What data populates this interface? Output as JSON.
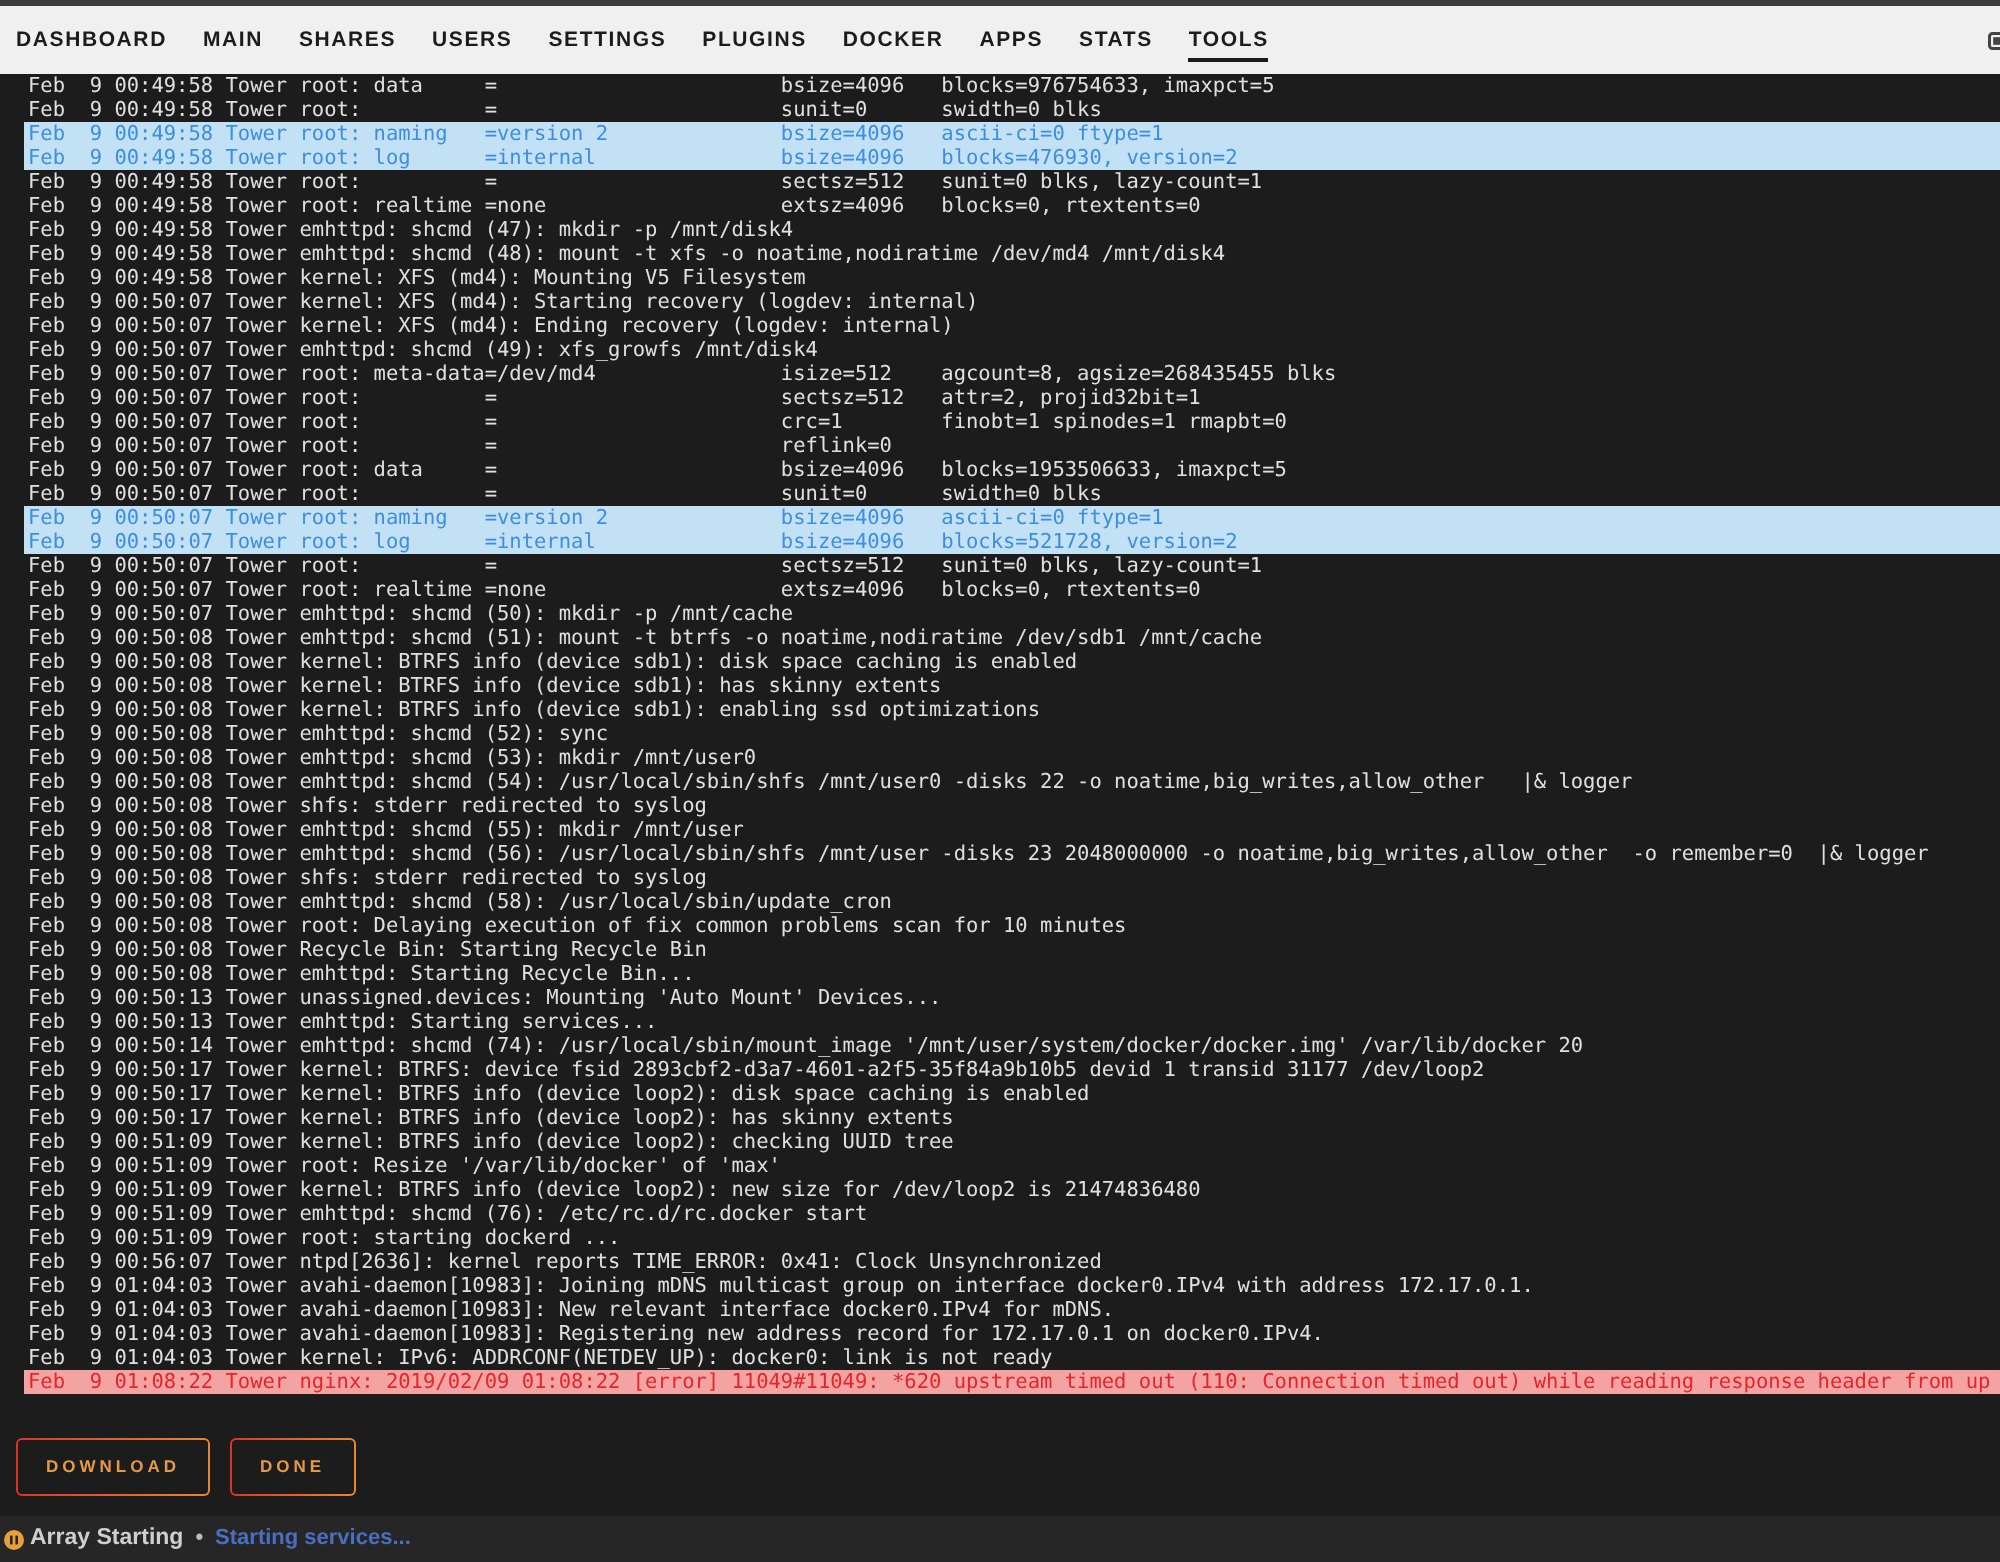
{
  "nav": {
    "tabs": [
      {
        "label": "DASHBOARD",
        "selected": false
      },
      {
        "label": "MAIN",
        "selected": false
      },
      {
        "label": "SHARES",
        "selected": false
      },
      {
        "label": "USERS",
        "selected": false
      },
      {
        "label": "SETTINGS",
        "selected": false
      },
      {
        "label": "PLUGINS",
        "selected": false
      },
      {
        "label": "DOCKER",
        "selected": false
      },
      {
        "label": "APPS",
        "selected": false
      },
      {
        "label": "STATS",
        "selected": false
      },
      {
        "label": "TOOLS",
        "selected": true
      }
    ]
  },
  "log": {
    "lines": [
      {
        "kind": "normal",
        "text": "Feb  9 00:49:58 Tower root: data     =                       bsize=4096   blocks=976754633, imaxpct=5"
      },
      {
        "kind": "normal",
        "text": "Feb  9 00:49:58 Tower root:          =                       sunit=0      swidth=0 blks"
      },
      {
        "kind": "highlight",
        "text": "Feb  9 00:49:58 Tower root: naming   =version 2              bsize=4096   ascii-ci=0 ftype=1"
      },
      {
        "kind": "highlight",
        "text": "Feb  9 00:49:58 Tower root: log      =internal               bsize=4096   blocks=476930, version=2"
      },
      {
        "kind": "normal",
        "text": "Feb  9 00:49:58 Tower root:          =                       sectsz=512   sunit=0 blks, lazy-count=1"
      },
      {
        "kind": "normal",
        "text": "Feb  9 00:49:58 Tower root: realtime =none                   extsz=4096   blocks=0, rtextents=0"
      },
      {
        "kind": "normal",
        "text": "Feb  9 00:49:58 Tower emhttpd: shcmd (47): mkdir -p /mnt/disk4"
      },
      {
        "kind": "normal",
        "text": "Feb  9 00:49:58 Tower emhttpd: shcmd (48): mount -t xfs -o noatime,nodiratime /dev/md4 /mnt/disk4"
      },
      {
        "kind": "normal",
        "text": "Feb  9 00:49:58 Tower kernel: XFS (md4): Mounting V5 Filesystem"
      },
      {
        "kind": "normal",
        "text": "Feb  9 00:50:07 Tower kernel: XFS (md4): Starting recovery (logdev: internal)"
      },
      {
        "kind": "normal",
        "text": "Feb  9 00:50:07 Tower kernel: XFS (md4): Ending recovery (logdev: internal)"
      },
      {
        "kind": "normal",
        "text": "Feb  9 00:50:07 Tower emhttpd: shcmd (49): xfs_growfs /mnt/disk4"
      },
      {
        "kind": "normal",
        "text": "Feb  9 00:50:07 Tower root: meta-data=/dev/md4               isize=512    agcount=8, agsize=268435455 blks"
      },
      {
        "kind": "normal",
        "text": "Feb  9 00:50:07 Tower root:          =                       sectsz=512   attr=2, projid32bit=1"
      },
      {
        "kind": "normal",
        "text": "Feb  9 00:50:07 Tower root:          =                       crc=1        finobt=1 spinodes=1 rmapbt=0"
      },
      {
        "kind": "normal",
        "text": "Feb  9 00:50:07 Tower root:          =                       reflink=0"
      },
      {
        "kind": "normal",
        "text": "Feb  9 00:50:07 Tower root: data     =                       bsize=4096   blocks=1953506633, imaxpct=5"
      },
      {
        "kind": "normal",
        "text": "Feb  9 00:50:07 Tower root:          =                       sunit=0      swidth=0 blks"
      },
      {
        "kind": "highlight",
        "text": "Feb  9 00:50:07 Tower root: naming   =version 2              bsize=4096   ascii-ci=0 ftype=1"
      },
      {
        "kind": "highlight",
        "text": "Feb  9 00:50:07 Tower root: log      =internal               bsize=4096   blocks=521728, version=2"
      },
      {
        "kind": "normal",
        "text": "Feb  9 00:50:07 Tower root:          =                       sectsz=512   sunit=0 blks, lazy-count=1"
      },
      {
        "kind": "normal",
        "text": "Feb  9 00:50:07 Tower root: realtime =none                   extsz=4096   blocks=0, rtextents=0"
      },
      {
        "kind": "normal",
        "text": "Feb  9 00:50:07 Tower emhttpd: shcmd (50): mkdir -p /mnt/cache"
      },
      {
        "kind": "normal",
        "text": "Feb  9 00:50:08 Tower emhttpd: shcmd (51): mount -t btrfs -o noatime,nodiratime /dev/sdb1 /mnt/cache"
      },
      {
        "kind": "normal",
        "text": "Feb  9 00:50:08 Tower kernel: BTRFS info (device sdb1): disk space caching is enabled"
      },
      {
        "kind": "normal",
        "text": "Feb  9 00:50:08 Tower kernel: BTRFS info (device sdb1): has skinny extents"
      },
      {
        "kind": "normal",
        "text": "Feb  9 00:50:08 Tower kernel: BTRFS info (device sdb1): enabling ssd optimizations"
      },
      {
        "kind": "normal",
        "text": "Feb  9 00:50:08 Tower emhttpd: shcmd (52): sync"
      },
      {
        "kind": "normal",
        "text": "Feb  9 00:50:08 Tower emhttpd: shcmd (53): mkdir /mnt/user0"
      },
      {
        "kind": "normal",
        "text": "Feb  9 00:50:08 Tower emhttpd: shcmd (54): /usr/local/sbin/shfs /mnt/user0 -disks 22 -o noatime,big_writes,allow_other   |& logger"
      },
      {
        "kind": "normal",
        "text": "Feb  9 00:50:08 Tower shfs: stderr redirected to syslog"
      },
      {
        "kind": "normal",
        "text": "Feb  9 00:50:08 Tower emhttpd: shcmd (55): mkdir /mnt/user"
      },
      {
        "kind": "normal",
        "text": "Feb  9 00:50:08 Tower emhttpd: shcmd (56): /usr/local/sbin/shfs /mnt/user -disks 23 2048000000 -o noatime,big_writes,allow_other  -o remember=0  |& logger"
      },
      {
        "kind": "normal",
        "text": "Feb  9 00:50:08 Tower shfs: stderr redirected to syslog"
      },
      {
        "kind": "normal",
        "text": "Feb  9 00:50:08 Tower emhttpd: shcmd (58): /usr/local/sbin/update_cron"
      },
      {
        "kind": "normal",
        "text": "Feb  9 00:50:08 Tower root: Delaying execution of fix common problems scan for 10 minutes"
      },
      {
        "kind": "normal",
        "text": "Feb  9 00:50:08 Tower Recycle Bin: Starting Recycle Bin"
      },
      {
        "kind": "normal",
        "text": "Feb  9 00:50:08 Tower emhttpd: Starting Recycle Bin..."
      },
      {
        "kind": "normal",
        "text": "Feb  9 00:50:13 Tower unassigned.devices: Mounting 'Auto Mount' Devices..."
      },
      {
        "kind": "normal",
        "text": "Feb  9 00:50:13 Tower emhttpd: Starting services..."
      },
      {
        "kind": "normal",
        "text": "Feb  9 00:50:14 Tower emhttpd: shcmd (74): /usr/local/sbin/mount_image '/mnt/user/system/docker/docker.img' /var/lib/docker 20"
      },
      {
        "kind": "normal",
        "text": "Feb  9 00:50:17 Tower kernel: BTRFS: device fsid 2893cbf2-d3a7-4601-a2f5-35f84a9b10b5 devid 1 transid 31177 /dev/loop2"
      },
      {
        "kind": "normal",
        "text": "Feb  9 00:50:17 Tower kernel: BTRFS info (device loop2): disk space caching is enabled"
      },
      {
        "kind": "normal",
        "text": "Feb  9 00:50:17 Tower kernel: BTRFS info (device loop2): has skinny extents"
      },
      {
        "kind": "normal",
        "text": "Feb  9 00:51:09 Tower kernel: BTRFS info (device loop2): checking UUID tree"
      },
      {
        "kind": "normal",
        "text": "Feb  9 00:51:09 Tower root: Resize '/var/lib/docker' of 'max'"
      },
      {
        "kind": "normal",
        "text": "Feb  9 00:51:09 Tower kernel: BTRFS info (device loop2): new size for /dev/loop2 is 21474836480"
      },
      {
        "kind": "normal",
        "text": "Feb  9 00:51:09 Tower emhttpd: shcmd (76): /etc/rc.d/rc.docker start"
      },
      {
        "kind": "normal",
        "text": "Feb  9 00:51:09 Tower root: starting dockerd ..."
      },
      {
        "kind": "normal",
        "text": "Feb  9 00:56:07 Tower ntpd[2636]: kernel reports TIME_ERROR: 0x41: Clock Unsynchronized"
      },
      {
        "kind": "normal",
        "text": "Feb  9 01:04:03 Tower avahi-daemon[10983]: Joining mDNS multicast group on interface docker0.IPv4 with address 172.17.0.1."
      },
      {
        "kind": "normal",
        "text": "Feb  9 01:04:03 Tower avahi-daemon[10983]: New relevant interface docker0.IPv4 for mDNS."
      },
      {
        "kind": "normal",
        "text": "Feb  9 01:04:03 Tower avahi-daemon[10983]: Registering new address record for 172.17.0.1 on docker0.IPv4."
      },
      {
        "kind": "normal",
        "text": "Feb  9 01:04:03 Tower kernel: IPv6: ADDRCONF(NETDEV_UP): docker0: link is not ready"
      },
      {
        "kind": "error",
        "text": "Feb  9 01:08:22 Tower nginx: 2019/02/09 01:08:22 [error] 11049#11049: *620 upstream timed out (110: Connection timed out) while reading response header from up"
      }
    ]
  },
  "buttons": [
    "DOWNLOAD",
    "DONE"
  ],
  "status_bar": {
    "state": "Array Starting",
    "separator": "•",
    "message": "Starting services..."
  }
}
